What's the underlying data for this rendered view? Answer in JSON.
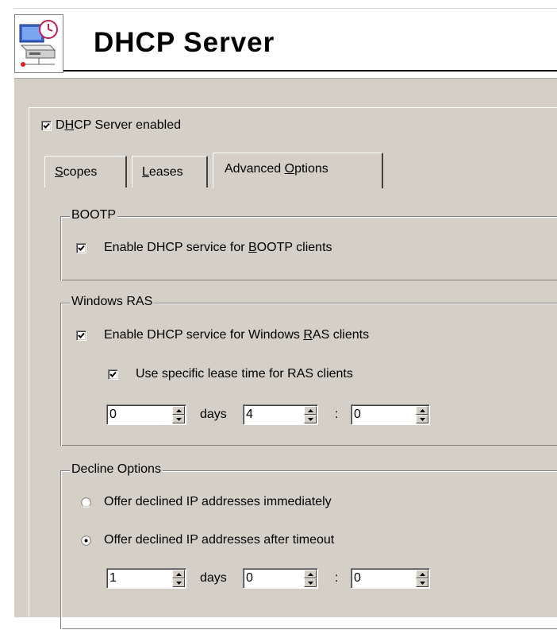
{
  "header": {
    "title": "DHCP Server",
    "icon": "dhcp-server-icon"
  },
  "main": {
    "enabled_checkbox": {
      "label_pre": "D",
      "label_mnemonic": "H",
      "label_post": "CP Server enabled",
      "checked": true
    }
  },
  "tabs": [
    {
      "pre": "",
      "mnemonic": "S",
      "post": "copes",
      "active": false
    },
    {
      "pre": "",
      "mnemonic": "L",
      "post": "eases",
      "active": false
    },
    {
      "pre": "Advanced ",
      "mnemonic": "O",
      "post": "ptions",
      "active": true
    }
  ],
  "bootp": {
    "title": "BOOTP",
    "enable": {
      "pre": "Enable DHCP service for ",
      "mnemonic": "B",
      "post": "OOTP clients",
      "checked": true
    }
  },
  "ras": {
    "title": "Windows RAS",
    "enable": {
      "pre": "Enable DHCP service for Windows ",
      "mnemonic": "R",
      "post": "AS clients",
      "checked": true
    },
    "lease": {
      "label": "Use specific lease time for RAS clients",
      "checked": true
    },
    "days_value": "0",
    "days_label": "days",
    "hours_value": "4",
    "sep": ":",
    "minutes_value": "0"
  },
  "decline": {
    "title": "Decline Options",
    "opt_immediately": {
      "label": "Offer declined IP addresses immediately",
      "selected": false
    },
    "opt_timeout": {
      "label": "Offer declined IP addresses after timeout",
      "selected": true
    },
    "days_value": "1",
    "days_label": "days",
    "hours_value": "0",
    "sep": ":",
    "minutes_value": "0"
  }
}
